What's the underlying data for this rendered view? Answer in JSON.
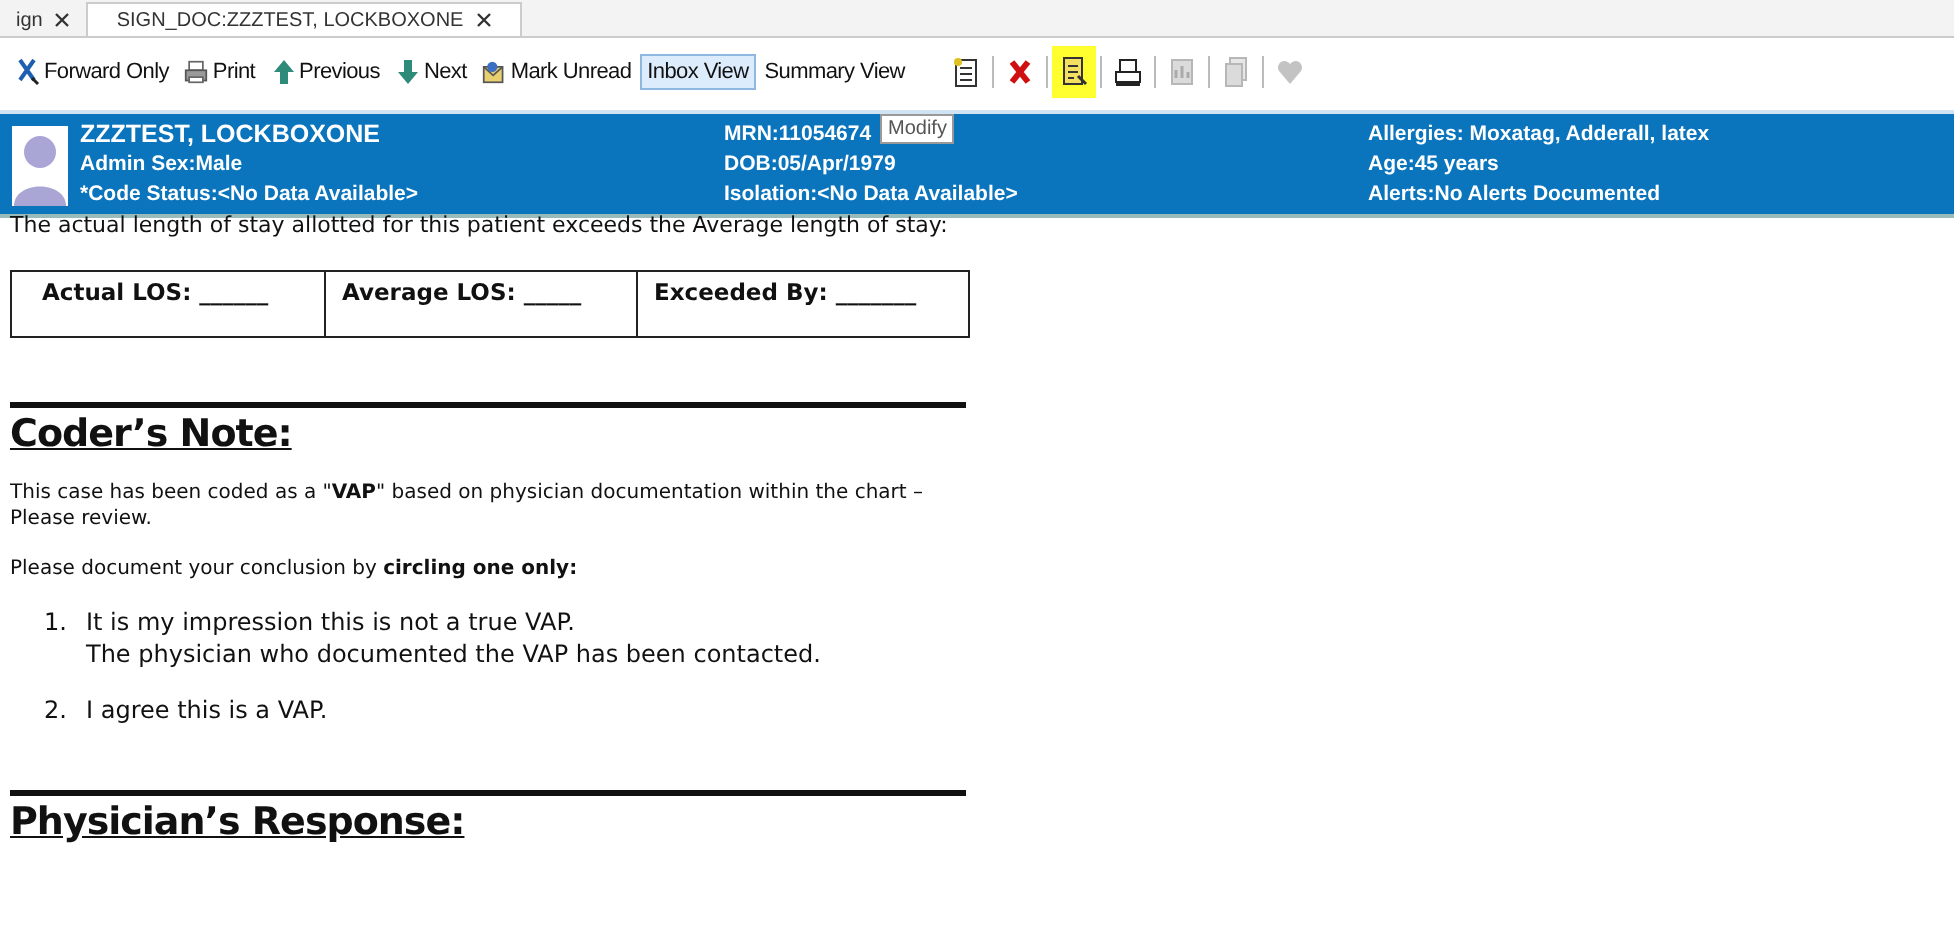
{
  "tabs": [
    {
      "label": "ign",
      "selected": false
    },
    {
      "label": "SIGN_DOC:ZZZTEST, LOCKBOXONE",
      "selected": true
    }
  ],
  "toolbar": {
    "text_buttons": [
      {
        "label": "Forward Only",
        "selected": false
      },
      {
        "label": "Print",
        "selected": false
      },
      {
        "label": "Previous",
        "selected": false
      },
      {
        "label": "Next",
        "selected": false
      },
      {
        "label": "Mark Unread",
        "selected": false
      },
      {
        "label": "Inbox View",
        "selected": true
      },
      {
        "label": "Summary View",
        "selected": false
      }
    ],
    "icon_buttons": [
      {
        "kind": "new-document",
        "highlighted": false,
        "disabled": false
      },
      {
        "kind": "delete",
        "highlighted": false,
        "disabled": false
      },
      {
        "kind": "modify",
        "highlighted": true,
        "disabled": false
      },
      {
        "kind": "print",
        "highlighted": false,
        "disabled": false
      },
      {
        "kind": "chart",
        "highlighted": false,
        "disabled": true
      },
      {
        "kind": "pages",
        "highlighted": false,
        "disabled": true
      },
      {
        "kind": "heart",
        "highlighted": false,
        "disabled": true
      }
    ],
    "tooltip": "Modify"
  },
  "banner": {
    "name": "ZZZTEST, LOCKBOXONE",
    "col1": [
      "Admin Sex:Male",
      "*Code Status:<No Data Available>"
    ],
    "col2": [
      "MRN:11054674",
      "DOB:05/Apr/1979",
      "Isolation:<No Data Available>"
    ],
    "col3": [
      "Allergies: Moxatag, Adderall, latex",
      "Age:45 years",
      "Alerts:No Alerts Documented"
    ]
  },
  "document": {
    "intro": "The actual length of stay allotted for this patient exceeds the Average length of stay:",
    "los_table": [
      "Actual LOS: ______",
      "Average LOS: _____",
      "Exceeded By: _______"
    ],
    "coder_heading": "Coder’s Note:",
    "paragraphs": [
      "This case has been coded as a \"**VAP**\" based on physician documentation within the chart – Please review.",
      "Please document your conclusion by **circling one only:**"
    ],
    "options": [
      {
        "number": "1.",
        "lines": [
          "It is my impression this is not a true VAP.",
          "The physician who documented the VAP has been contacted."
        ]
      },
      {
        "number": "2.",
        "lines": [
          "I agree this is a VAP."
        ]
      }
    ],
    "response_heading": "Physician’s Response:"
  }
}
